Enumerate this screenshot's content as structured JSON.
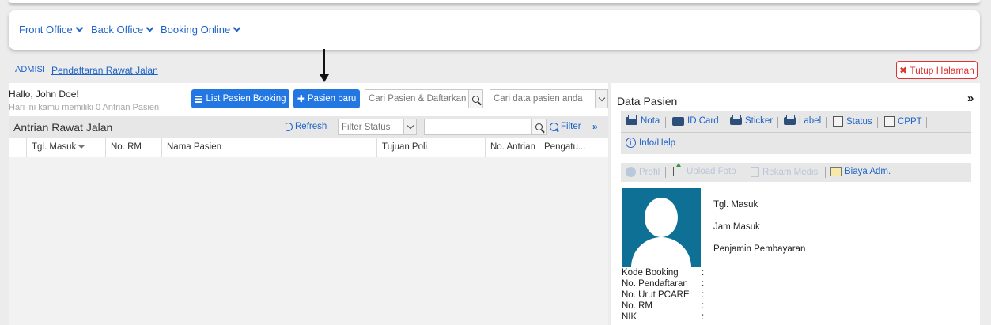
{
  "nav": {
    "items": [
      "Front Office",
      "Back Office",
      "Booking Online"
    ]
  },
  "breadcrumb": {
    "root": "ADMISI",
    "current": "Pendaftaran Rawat Jalan"
  },
  "close_button": "Tutup Halaman",
  "left": {
    "greeting": "Hallo, John Doe!",
    "subtitle": "Hari ini kamu memiliki 0 Antrian Pasien",
    "btn_list_booking": "List Pasien Booking",
    "btn_new_patient": "Pasien baru",
    "search_register_placeholder": "Cari Pasien & Daftarkan",
    "search_patient_placeholder": "Cari data pasien anda",
    "queue": {
      "title": "Antrian Rawat Jalan",
      "refresh": "Refresh",
      "filter_status_placeholder": "Filter Status",
      "filter_label": "Filter",
      "more": "»"
    },
    "table": {
      "columns": [
        "Tgl. Masuk",
        "No. RM",
        "Nama Pasien",
        "Tujuan Poli",
        "No. Antrian",
        "Pengatu..."
      ]
    }
  },
  "right": {
    "title": "Data Pasien",
    "collapse": "»",
    "toolbar": {
      "nota": "Nota",
      "id_card": "ID Card",
      "sticker": "Sticker",
      "label": "Label",
      "status": "Status",
      "cppt": "CPPT",
      "info": "Info/Help"
    },
    "toolbar2": {
      "profil": "Profil",
      "upload_foto": "Upload Foto",
      "rekam_medis": "Rekam Medis",
      "biaya_adm": "Biaya Adm."
    },
    "info_right": [
      "Tgl. Masuk",
      "Jam Masuk",
      "Penjamin Pembayaran"
    ],
    "info_left": [
      "Kode Booking",
      "No. Pendaftaran",
      "No. Urut PCARE",
      "No. RM",
      "NIK"
    ],
    "colon": ":"
  },
  "colors": {
    "primary": "#2377e3",
    "link": "#1e63c8",
    "danger": "#dd3333",
    "photo_bg": "#0f7096"
  }
}
